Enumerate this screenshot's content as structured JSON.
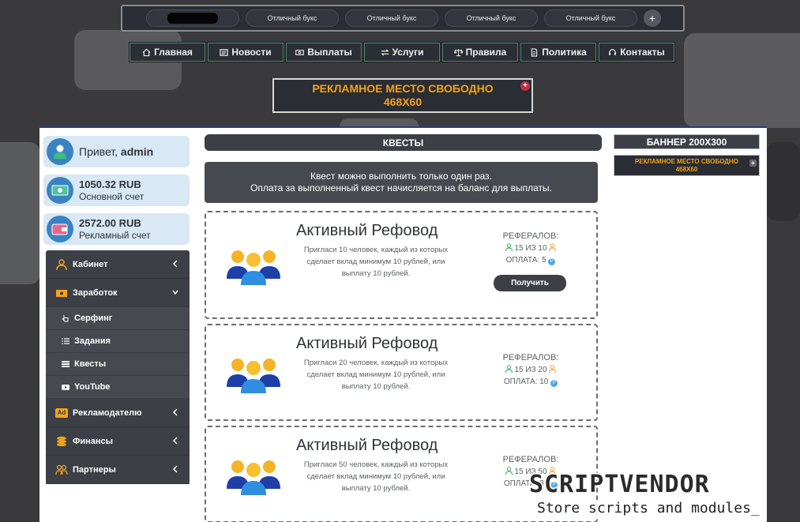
{
  "top_tabs": {
    "items": [
      {
        "label": ""
      },
      {
        "label": "Отличный букс"
      },
      {
        "label": "Отличный букс"
      },
      {
        "label": "Отличный букс"
      },
      {
        "label": "Отличный букс"
      }
    ],
    "add_label": "+"
  },
  "nav": {
    "items": [
      {
        "label": "Главная",
        "icon": "home-icon"
      },
      {
        "label": "Новости",
        "icon": "newspaper-icon"
      },
      {
        "label": "Выплаты",
        "icon": "money-icon"
      },
      {
        "label": "Услуги",
        "icon": "exchange-icon"
      },
      {
        "label": "Правила",
        "icon": "scales-icon"
      },
      {
        "label": "Политика",
        "icon": "document-icon"
      },
      {
        "label": "Контакты",
        "icon": "headset-icon"
      }
    ]
  },
  "ad_banner": {
    "line1": "РЕКЛАМНОЕ МЕСТО СВОБОДНО",
    "line2": "468X60",
    "plus": "+"
  },
  "user": {
    "greeting": "Привет,",
    "name": "admin",
    "main_balance": "1050.32 RUB",
    "main_label": "Основной счет",
    "ad_balance": "2572.00 RUB",
    "ad_label": "Рекламный счет"
  },
  "menu": {
    "cabinet": "Кабинет",
    "earnings": "Заработок",
    "surfing": "Серфинг",
    "tasks": "Задания",
    "quests": "Квесты",
    "youtube": "YouTube",
    "advertiser": "Рекламодателю",
    "finance": "Финансы",
    "partners": "Партнеры",
    "advertiser_badge": "Ad"
  },
  "quests": {
    "header": "КВЕСТЫ",
    "notice_line1": "Квест можно выполнить только один раз.",
    "notice_line2": "Оплата за выполненный квест начисляется на баланс для выплаты.",
    "items": [
      {
        "title": "Активный Рефовод",
        "desc": "Пригласи 10 человек, каждый из которых сделает вклад минимум 10 рублей, или выплату 10 рублей.",
        "refs_label": "РЕФЕРАЛОВ:",
        "progress": "15 ИЗ 10",
        "payment": "ОПЛАТА: 5",
        "button": "Получить"
      },
      {
        "title": "Активный Рефовод",
        "desc": "Пригласи 20 человек, каждый из которых сделает вклад минимум 10 рублей, или выплату 10 рублей.",
        "refs_label": "РЕФЕРАЛОВ:",
        "progress": "15 ИЗ 20",
        "payment": "ОПЛАТА: 10"
      },
      {
        "title": "Активный Рефовод",
        "desc": "Пригласи 50 человек, каждый из которых сделает вклад минимум 10 рублей, или выплату 10 рублей.",
        "refs_label": "РЕФЕРАЛОВ:",
        "progress": "15 ИЗ 50",
        "payment": "ОПЛАТА: 30"
      }
    ],
    "coin_symbol": "P"
  },
  "right": {
    "banner_title": "БАННЕР 200Х300",
    "ad_line1": "РЕКЛАМНОЕ МЕСТО СВОБОДНО",
    "ad_line2": "468X60",
    "ad_plus": "+"
  },
  "watermark": {
    "title": "SCRIPTVENDOR",
    "subtitle": "Store scripts and modules_"
  },
  "colors": {
    "accent_orange": "#f3a21a",
    "dark": "#3c3f45",
    "panel_border": "#2a3e8a"
  }
}
